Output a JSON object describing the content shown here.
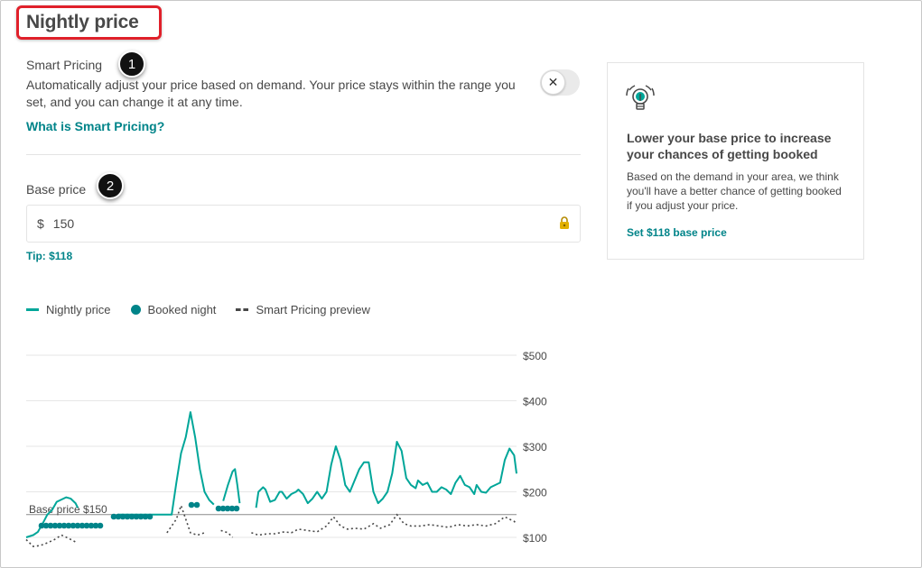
{
  "header": {
    "title": "Nightly price"
  },
  "smart_pricing": {
    "label": "Smart Pricing",
    "callout": "1",
    "description": "Automatically adjust your price based on demand. Your price stays within the range you set, and you can change it at any time.",
    "link": "What is Smart Pricing?",
    "toggle_icon": "x-icon",
    "toggle_state": "off",
    "toggle_glyph": "✕"
  },
  "base_price": {
    "label": "Base price",
    "callout": "2",
    "currency": "$",
    "value": "150",
    "tip": "Tip: $118",
    "lock_icon": "lock-icon"
  },
  "tip_card": {
    "icon": "lightbulb-icon",
    "title": "Lower your base price to increase your chances of getting booked",
    "body": "Based on the demand in your area, we think you'll have a better chance of getting booked if you adjust your price.",
    "link": "Set $118 base price"
  },
  "legend": [
    {
      "label": "Nightly price",
      "swatch": "line"
    },
    {
      "label": "Booked night",
      "swatch": "dot"
    },
    {
      "label": "Smart Pricing preview",
      "swatch": "dash"
    }
  ],
  "colors": {
    "accent": "#008489",
    "line": "#00a699",
    "callout_border": "#e0202a",
    "text": "#484848"
  },
  "chart_data": {
    "type": "line",
    "ylim": [
      70,
      520
    ],
    "y_ticks": [
      {
        "value": 500,
        "label": "$500"
      },
      {
        "value": 400,
        "label": "$400"
      },
      {
        "value": 300,
        "label": "$300"
      },
      {
        "value": 200,
        "label": "$200"
      },
      {
        "value": 100,
        "label": "$100"
      }
    ],
    "base_line": {
      "value": 150,
      "label": "Base price $150"
    },
    "series": [
      {
        "name": "Nightly price",
        "segments": [
          [
            [
              0,
              100
            ],
            [
              3,
              105
            ],
            [
              5,
              112
            ],
            [
              7,
              130
            ],
            [
              9,
              150
            ],
            [
              11,
              160
            ],
            [
              13,
              178
            ],
            [
              15,
              183
            ],
            [
              17,
              188
            ],
            [
              19,
              185
            ],
            [
              21,
              175
            ],
            [
              22,
              165
            ]
          ],
          [
            [
              39,
              150
            ],
            [
              60,
              150
            ],
            [
              62,
              150
            ],
            [
              64,
              220
            ],
            [
              66,
              285
            ],
            [
              68,
              320
            ],
            [
              70,
              375
            ],
            [
              72,
              320
            ],
            [
              74,
              250
            ],
            [
              76,
              200
            ],
            [
              78,
              182
            ],
            [
              80,
              172
            ]
          ],
          [
            [
              84,
              180
            ],
            [
              86,
              215
            ],
            [
              88,
              245
            ],
            [
              89,
              250
            ],
            [
              90,
              215
            ],
            [
              91,
              175
            ]
          ],
          [
            [
              98,
              165
            ],
            [
              99,
              200
            ],
            [
              101,
              210
            ],
            [
              102,
              205
            ],
            [
              104,
              178
            ],
            [
              106,
              182
            ],
            [
              108,
              200
            ],
            [
              109,
              200
            ],
            [
              111,
              185
            ],
            [
              113,
              195
            ],
            [
              115,
              200
            ],
            [
              116,
              205
            ],
            [
              118,
              195
            ],
            [
              120,
              175
            ],
            [
              122,
              185
            ],
            [
              124,
              200
            ],
            [
              126,
              185
            ],
            [
              128,
              200
            ],
            [
              130,
              260
            ],
            [
              132,
              300
            ],
            [
              134,
              270
            ],
            [
              136,
              215
            ],
            [
              138,
              200
            ],
            [
              140,
              225
            ],
            [
              142,
              250
            ],
            [
              144,
              265
            ],
            [
              146,
              265
            ],
            [
              148,
              200
            ],
            [
              150,
              175
            ],
            [
              152,
              185
            ],
            [
              154,
              200
            ],
            [
              156,
              240
            ],
            [
              158,
              310
            ],
            [
              160,
              290
            ],
            [
              162,
              230
            ],
            [
              164,
              215
            ],
            [
              166,
              208
            ],
            [
              167,
              225
            ],
            [
              169,
              215
            ],
            [
              171,
              220
            ],
            [
              173,
              200
            ],
            [
              175,
              200
            ],
            [
              177,
              210
            ],
            [
              179,
              205
            ],
            [
              181,
              195
            ],
            [
              183,
              220
            ],
            [
              185,
              235
            ],
            [
              187,
              215
            ],
            [
              189,
              210
            ],
            [
              191,
              195
            ],
            [
              192,
              215
            ],
            [
              194,
              200
            ],
            [
              196,
              198
            ],
            [
              198,
              210
            ],
            [
              200,
              215
            ],
            [
              202,
              220
            ],
            [
              204,
              270
            ],
            [
              206,
              295
            ],
            [
              208,
              280
            ],
            [
              209,
              240
            ]
          ]
        ]
      },
      {
        "name": "Booked night",
        "points": [
          [
            0,
            150
          ],
          [
            3,
            150
          ],
          [
            5,
            150
          ],
          [
            7,
            150
          ],
          [
            9,
            150
          ],
          [
            11,
            150
          ],
          [
            13,
            150
          ],
          [
            15,
            150
          ],
          [
            17,
            150
          ],
          [
            19,
            150
          ],
          [
            21,
            150
          ],
          [
            23,
            150
          ],
          [
            25,
            150
          ],
          [
            27,
            150
          ],
          [
            29,
            150
          ],
          [
            31,
            150
          ],
          [
            33,
            150
          ],
          [
            35,
            150
          ],
          [
            37,
            150
          ],
          [
            39,
            150
          ],
          [
            41,
            150
          ],
          [
            43,
            150
          ],
          [
            45,
            150
          ],
          [
            47,
            150
          ],
          [
            49,
            150
          ],
          [
            51,
            150
          ],
          [
            53,
            150
          ],
          [
            55,
            150
          ],
          [
            57,
            150
          ],
          [
            59,
            150
          ],
          [
            61,
            150
          ]
        ]
      },
      {
        "name": "Smart Pricing preview",
        "segments": [
          [
            [
              0,
              95
            ],
            [
              3,
              80
            ],
            [
              6,
              82
            ],
            [
              9,
              88
            ],
            [
              12,
              95
            ],
            [
              15,
              105
            ],
            [
              18,
              98
            ],
            [
              21,
              90
            ]
          ],
          [
            [
              60,
              110
            ],
            [
              64,
              140
            ],
            [
              66,
              170
            ],
            [
              68,
              140
            ],
            [
              70,
              110
            ],
            [
              73,
              105
            ],
            [
              76,
              110
            ]
          ],
          [
            [
              83,
              115
            ],
            [
              86,
              110
            ],
            [
              88,
              100
            ]
          ],
          [
            [
              96,
              110
            ],
            [
              99,
              105
            ],
            [
              103,
              108
            ],
            [
              106,
              108
            ],
            [
              110,
              112
            ],
            [
              113,
              110
            ],
            [
              116,
              118
            ],
            [
              120,
              115
            ],
            [
              124,
              112
            ],
            [
              128,
              125
            ],
            [
              131,
              145
            ],
            [
              134,
              125
            ],
            [
              137,
              118
            ],
            [
              140,
              120
            ],
            [
              144,
              118
            ],
            [
              148,
              130
            ],
            [
              151,
              120
            ],
            [
              155,
              128
            ],
            [
              158,
              150
            ],
            [
              161,
              130
            ],
            [
              164,
              125
            ],
            [
              168,
              125
            ],
            [
              172,
              128
            ],
            [
              176,
              125
            ],
            [
              180,
              122
            ],
            [
              184,
              128
            ],
            [
              188,
              125
            ],
            [
              192,
              128
            ],
            [
              196,
              125
            ],
            [
              200,
              130
            ],
            [
              204,
              145
            ],
            [
              208,
              135
            ],
            [
              209,
              130
            ]
          ]
        ]
      }
    ]
  }
}
